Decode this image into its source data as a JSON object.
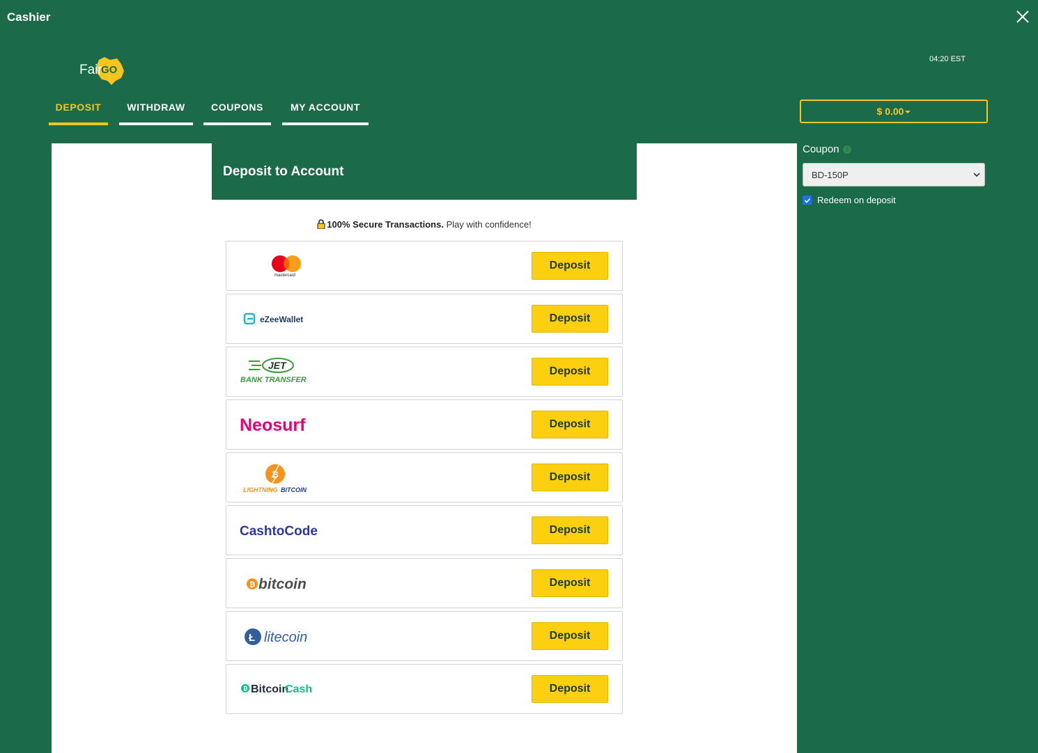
{
  "window": {
    "title": "Cashier"
  },
  "header": {
    "clock": "04:20 EST",
    "logo_text": "Fair",
    "logo_mark": "GO"
  },
  "tabs": [
    {
      "label": "DEPOSIT",
      "active": true
    },
    {
      "label": "WITHDRAW",
      "active": false
    },
    {
      "label": "COUPONS",
      "active": false
    },
    {
      "label": "MY ACCOUNT",
      "active": false
    }
  ],
  "balance": {
    "label": "$ 0.00"
  },
  "deposit_panel": {
    "title": "Deposit to Account",
    "secure_bold": "100% Secure Transactions.",
    "secure_text": " Play with confidence!"
  },
  "methods": [
    {
      "name": "mastercard",
      "logo_text": "mastercard",
      "button": "Deposit"
    },
    {
      "name": "eZeeWallet",
      "logo_text": "eZeeWallet",
      "button": "Deposit"
    },
    {
      "name": "Jet Bank Transfer",
      "logo_text": "JET",
      "logo_sub": "BANK TRANSFER",
      "button": "Deposit"
    },
    {
      "name": "Neosurf",
      "logo_text": "Neosurf",
      "button": "Deposit"
    },
    {
      "name": "Lightning Bitcoin",
      "logo_text": "LIGHTNING",
      "logo_sub": "BITCOIN",
      "button": "Deposit"
    },
    {
      "name": "CashtoCode",
      "logo_text": "CashtoCode",
      "button": "Deposit"
    },
    {
      "name": "bitcoin",
      "logo_text": "bitcoin",
      "button": "Deposit"
    },
    {
      "name": "litecoin",
      "logo_text": "litecoin",
      "button": "Deposit"
    },
    {
      "name": "BitcoinCash",
      "logo_text": "Bitcoin",
      "logo_sub": "Cash",
      "button": "Deposit"
    }
  ],
  "coupon": {
    "label": "Coupon",
    "selected": "BD-150P",
    "redeem_label": "Redeem on deposit",
    "redeem_checked": true
  },
  "colors": {
    "brand_green": "#1b6a4a",
    "accent_yellow": "#f7c51c",
    "button_yellow": "#fcd00f"
  }
}
